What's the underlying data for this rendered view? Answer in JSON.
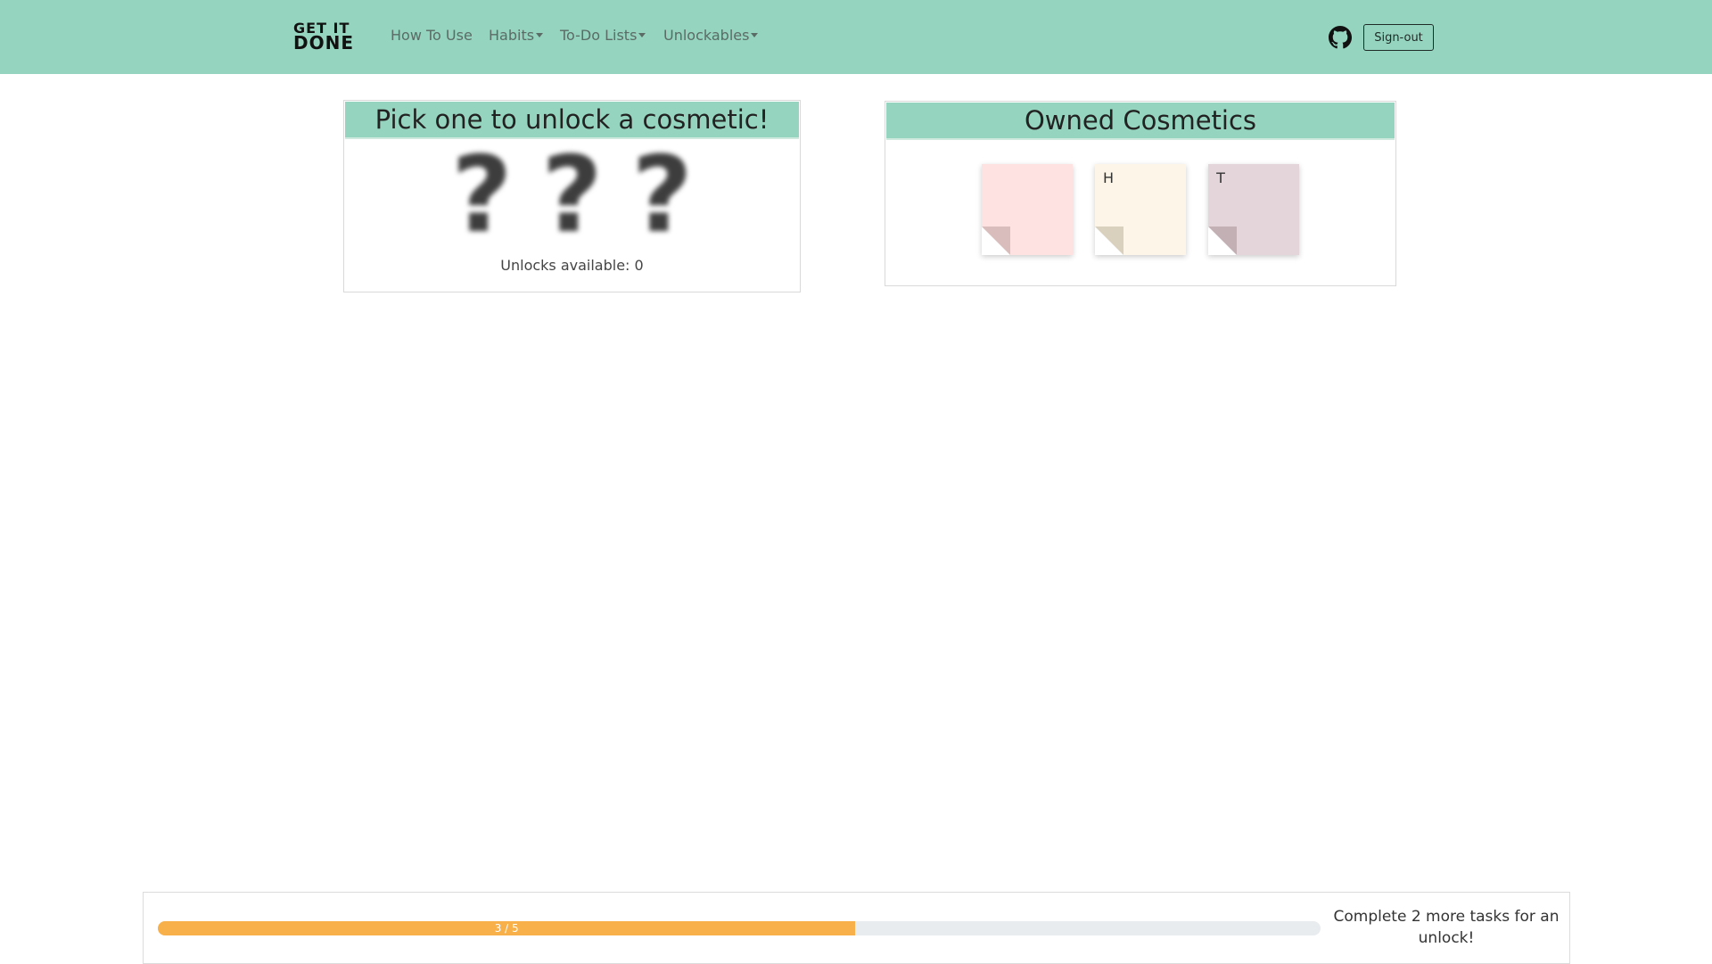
{
  "navbar": {
    "brand_line1": "GET IT",
    "brand_line2": "DONE",
    "items": [
      {
        "label": "How To Use",
        "dropdown": false
      },
      {
        "label": "Habits",
        "dropdown": true
      },
      {
        "label": "To-Do Lists",
        "dropdown": true
      },
      {
        "label": "Unlockables",
        "dropdown": true
      }
    ],
    "github_icon": "github-icon",
    "signout_label": "Sign-out"
  },
  "pick": {
    "title": "Pick one to unlock a cosmetic!",
    "mystery": [
      "?",
      "?",
      "?"
    ],
    "unlocks_text": "Unlocks available: 0"
  },
  "owned": {
    "title": "Owned Cosmetics",
    "notes": [
      {
        "letter": "",
        "color": "#fee1e1",
        "fold": "#d9bcbc"
      },
      {
        "letter": "H",
        "color": "#fdf6e8",
        "fold": "#d9d0bd"
      },
      {
        "letter": "T",
        "color": "#e4d5da",
        "fold": "#c2b0b5"
      }
    ]
  },
  "footer": {
    "progress_current": 3,
    "progress_total": 5,
    "progress_label": "3 / 5",
    "progress_color": "#f8b14a",
    "message": "Complete 2 more tasks for an unlock!"
  },
  "colors": {
    "accent": "#95d5bf"
  }
}
